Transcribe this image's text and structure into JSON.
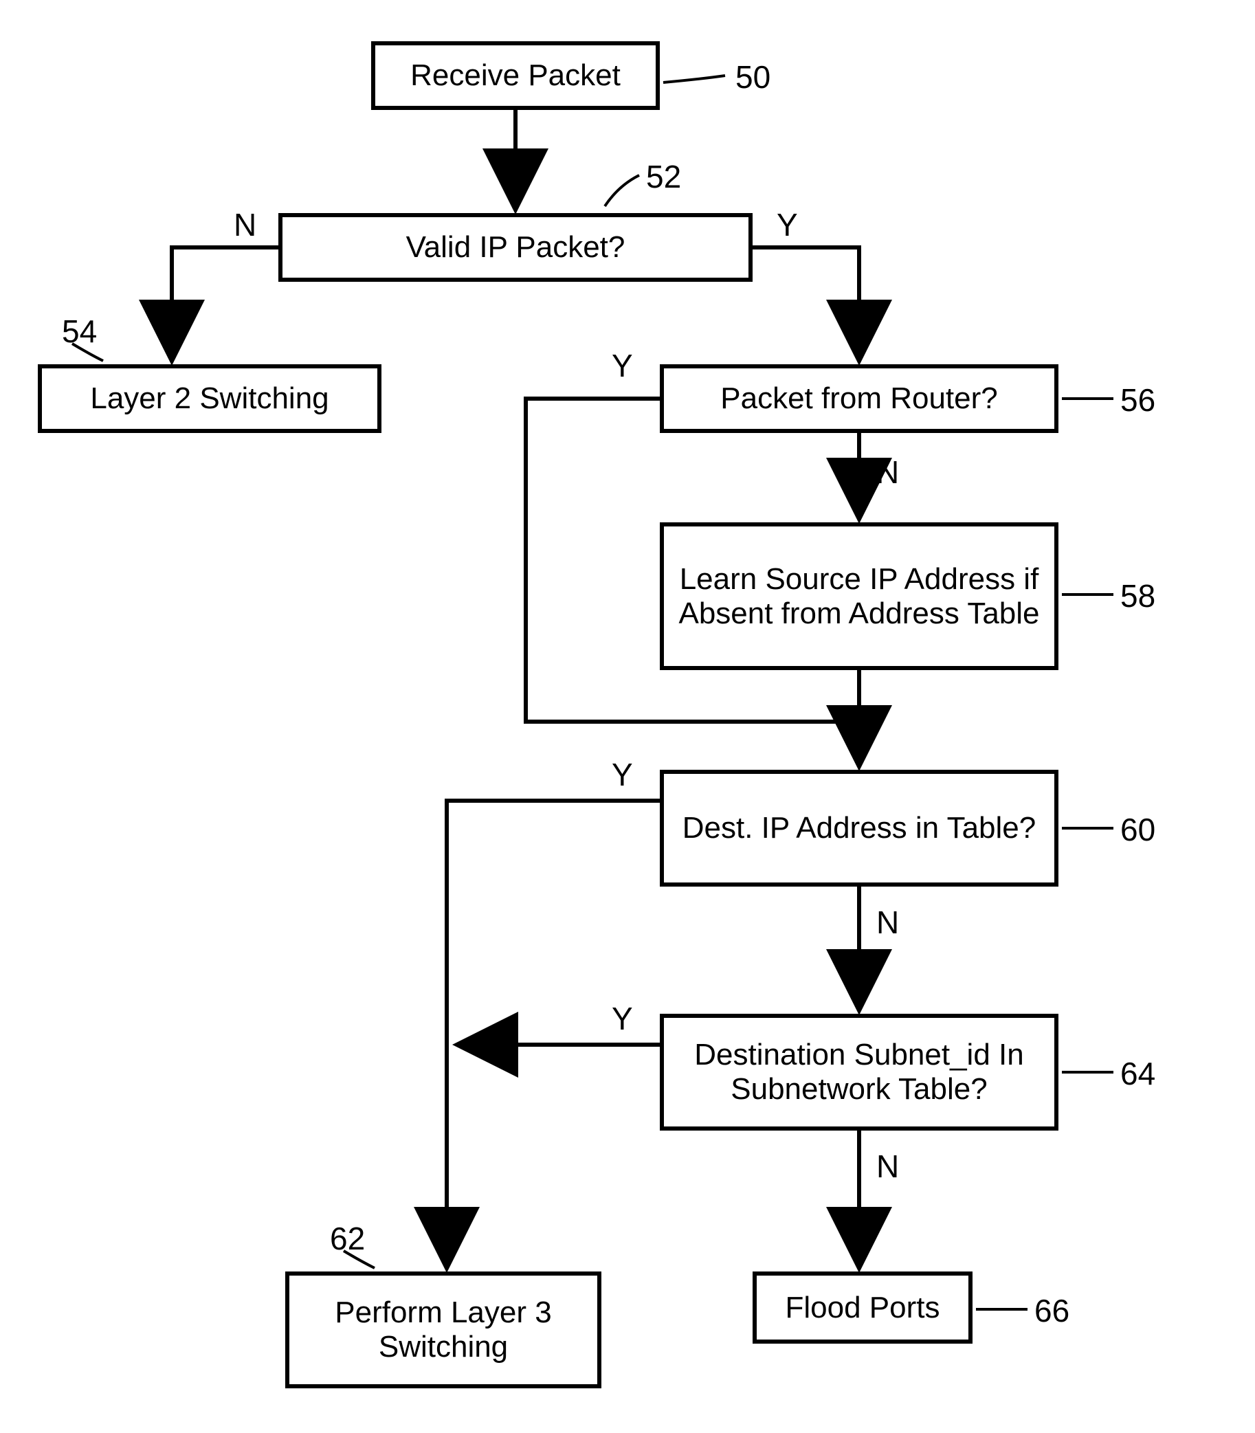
{
  "nodes": {
    "50": {
      "text": "Receive Packet",
      "ref": "50"
    },
    "52": {
      "text": "Valid IP Packet?",
      "ref": "52"
    },
    "54": {
      "text": "Layer 2 Switching",
      "ref": "54"
    },
    "56": {
      "text": "Packet from Router?",
      "ref": "56"
    },
    "58": {
      "text": "Learn Source IP Address if Absent from Address Table",
      "ref": "58"
    },
    "60": {
      "text": "Dest. IP Address in Table?",
      "ref": "60"
    },
    "62": {
      "text": "Perform Layer 3 Switching",
      "ref": "62"
    },
    "64": {
      "text": "Destination Subnet_id In Subnetwork Table?",
      "ref": "64"
    },
    "66": {
      "text": "Flood Ports",
      "ref": "66"
    }
  },
  "edgeLabels": {
    "yes": "Y",
    "no": "N"
  }
}
